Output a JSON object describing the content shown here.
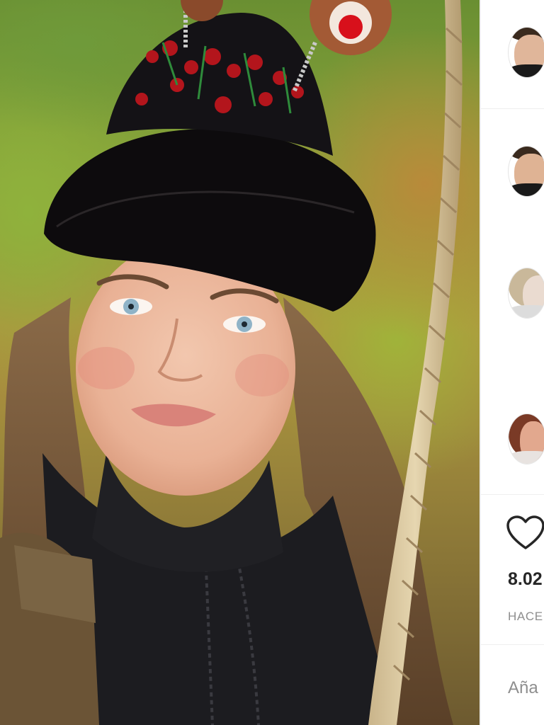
{
  "post": {
    "likes_text": "8.02",
    "timestamp_text": "HACE",
    "add_comment_placeholder": "Aña"
  },
  "comments": [
    {
      "avatar": "avatar-young-man"
    },
    {
      "avatar": "avatar-young-man"
    },
    {
      "avatar": "avatar-woman-blonde"
    },
    {
      "avatar": "avatar-woman-brunette"
    }
  ],
  "icons": {
    "like": "heart-outline-icon"
  },
  "colors": {
    "text_primary": "#262626",
    "text_secondary": "#8e8e8e",
    "divider": "#efefef"
  }
}
